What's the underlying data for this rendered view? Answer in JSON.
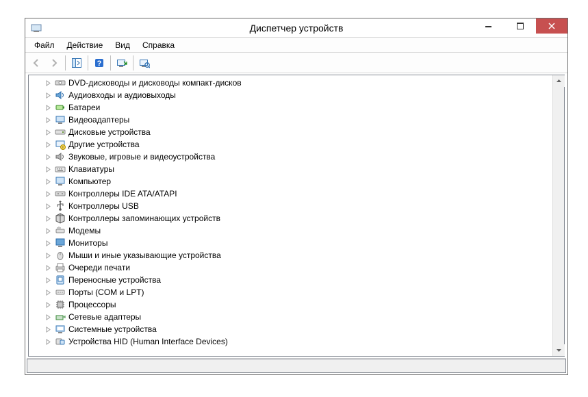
{
  "window_title": "Диспетчер устройств",
  "menu": [
    "Файл",
    "Действие",
    "Вид",
    "Справка"
  ],
  "tree": [
    {
      "icon": "disc-drive-icon",
      "label": "DVD-дисководы и дисководы компакт-дисков"
    },
    {
      "icon": "audio-io-icon",
      "label": "Аудиовходы и аудиовыходы"
    },
    {
      "icon": "battery-icon",
      "label": "Батареи"
    },
    {
      "icon": "display-adapter-icon",
      "label": "Видеоадаптеры"
    },
    {
      "icon": "disk-drive-icon",
      "label": "Дисковые устройства"
    },
    {
      "icon": "other-device-icon",
      "label": "Другие устройства"
    },
    {
      "icon": "sound-icon",
      "label": "Звуковые, игровые и видеоустройства"
    },
    {
      "icon": "keyboard-icon",
      "label": "Клавиатуры"
    },
    {
      "icon": "computer-icon",
      "label": "Компьютер"
    },
    {
      "icon": "ide-ata-icon",
      "label": "Контроллеры IDE ATA/ATAPI"
    },
    {
      "icon": "usb-icon",
      "label": "Контроллеры USB"
    },
    {
      "icon": "storage-controller-icon",
      "label": "Контроллеры запоминающих устройств"
    },
    {
      "icon": "modem-icon",
      "label": "Модемы"
    },
    {
      "icon": "monitor-icon",
      "label": "Мониторы"
    },
    {
      "icon": "mouse-icon",
      "label": "Мыши и иные указывающие устройства"
    },
    {
      "icon": "print-queue-icon",
      "label": "Очереди печати"
    },
    {
      "icon": "portable-device-icon",
      "label": "Переносные устройства"
    },
    {
      "icon": "port-icon",
      "label": "Порты (COM и LPT)"
    },
    {
      "icon": "processor-icon",
      "label": "Процессоры"
    },
    {
      "icon": "network-adapter-icon",
      "label": "Сетевые адаптеры"
    },
    {
      "icon": "system-device-icon",
      "label": "Системные устройства"
    },
    {
      "icon": "hid-icon",
      "label": "Устройства HID (Human Interface Devices)"
    }
  ]
}
